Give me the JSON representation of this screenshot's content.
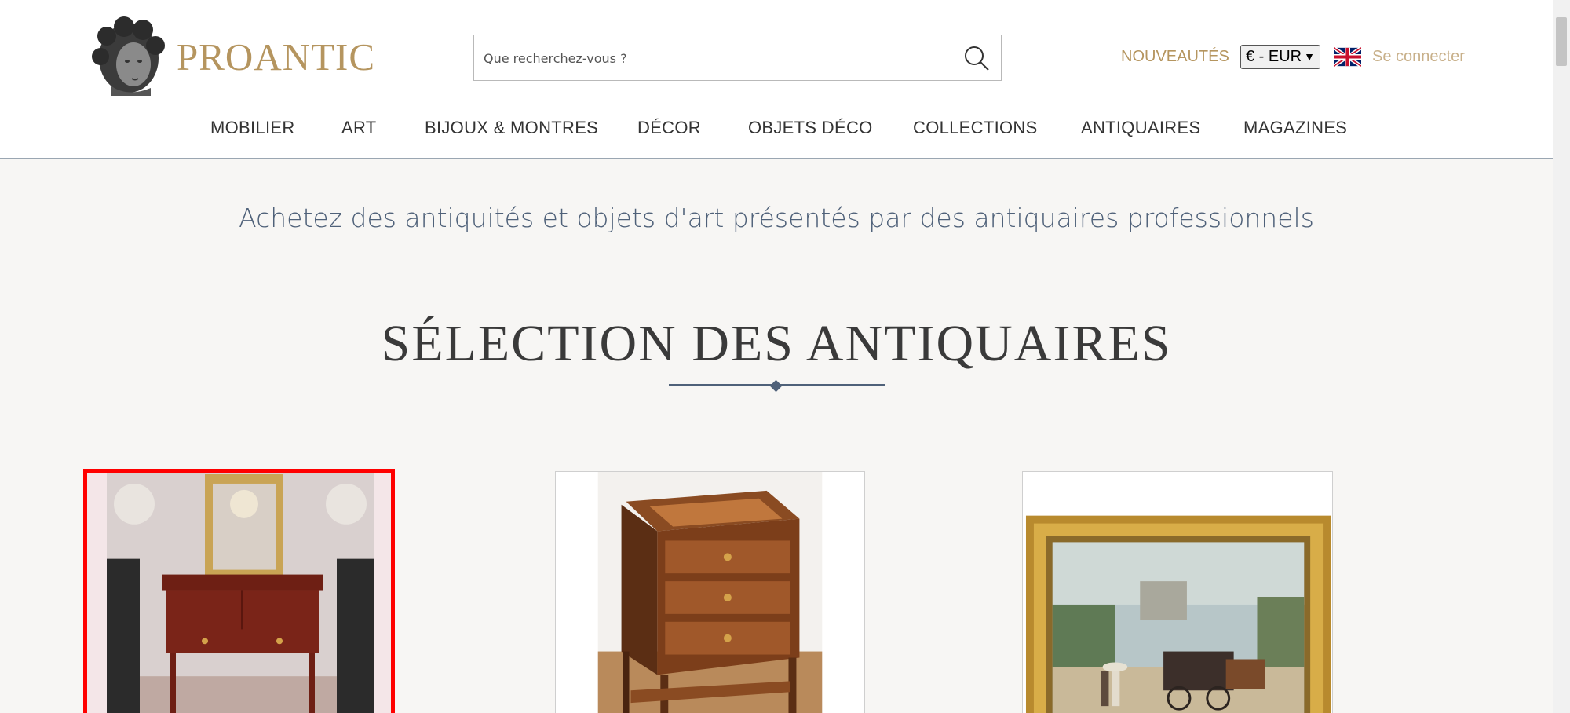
{
  "header": {
    "brand": "PROANTIC",
    "search": {
      "placeholder": "Que recherchez-vous ?",
      "value": ""
    },
    "new_items": "NOUVEAUTÉS",
    "currency": "€ - EUR",
    "login": "Se connecter"
  },
  "nav": [
    "MOBILIER",
    "ART",
    "BIJOUX & MONTRES",
    "DÉCOR",
    "OBJETS DÉCO",
    "COLLECTIONS",
    "ANTIQUAIRES",
    "MAGAZINES"
  ],
  "main": {
    "tagline": "Achetez des antiquités et objets d'art présentés par des antiquaires professionnels",
    "section_title": "SÉLECTION DES ANTIQUAIRES"
  },
  "products": [
    {
      "name": "console-with-mirror-and-vases",
      "selected": true
    },
    {
      "name": "marquetry-side-table",
      "selected": false
    },
    {
      "name": "framed-paris-street-painting",
      "selected": false
    }
  ],
  "colors": {
    "gold": "#b5955f",
    "blue_text": "#4f6179",
    "background": "#f7f6f4",
    "selection": "#ff0000"
  }
}
